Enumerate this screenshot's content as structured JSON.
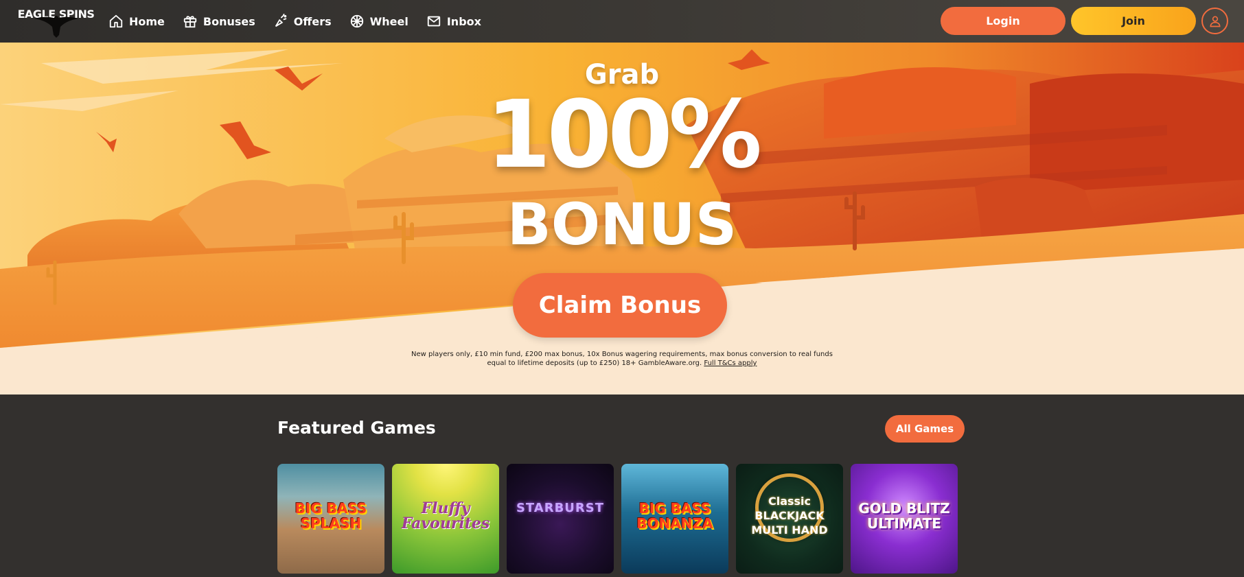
{
  "brand": {
    "logo_text": "EAGLE SPINS"
  },
  "nav": [
    {
      "label": "Home",
      "icon": "home-icon"
    },
    {
      "label": "Bonuses",
      "icon": "gift-icon"
    },
    {
      "label": "Offers",
      "icon": "offers-icon"
    },
    {
      "label": "Wheel",
      "icon": "wheel-icon"
    },
    {
      "label": "Inbox",
      "icon": "mail-icon"
    }
  ],
  "header": {
    "login_label": "Login",
    "join_label": "Join",
    "account_icon": "user-icon"
  },
  "hero": {
    "grab": "Grab",
    "headline": "100%",
    "subheadline": "BONUS",
    "cta_label": "Claim Bonus",
    "terms_line1": "New players only, £10 min fund, £200 max bonus, 10x Bonus wagering requirements, max bonus conversion to real funds",
    "terms_line2": "equal to lifetime deposits (up to £250) 18+ GambleAware.org.",
    "terms_link": "Full T&Cs apply"
  },
  "featured": {
    "title": "Featured Games",
    "all_games_label": "All Games",
    "games": [
      {
        "title": "BIG BASS SPLASH"
      },
      {
        "title": "Fluffy Favourites"
      },
      {
        "title": "STARBURST"
      },
      {
        "title": "BIG BASS BONANZA"
      },
      {
        "title": "Classic BLACKJACK MULTI HAND"
      },
      {
        "title": "GOLD BLITZ ULTIMATE"
      }
    ]
  },
  "colors": {
    "accent": "#f26c3e",
    "join": "#ffc52a",
    "header_bg": "#33302e",
    "page_bg": "#33302e",
    "hero_cream": "#fbe7cf"
  }
}
